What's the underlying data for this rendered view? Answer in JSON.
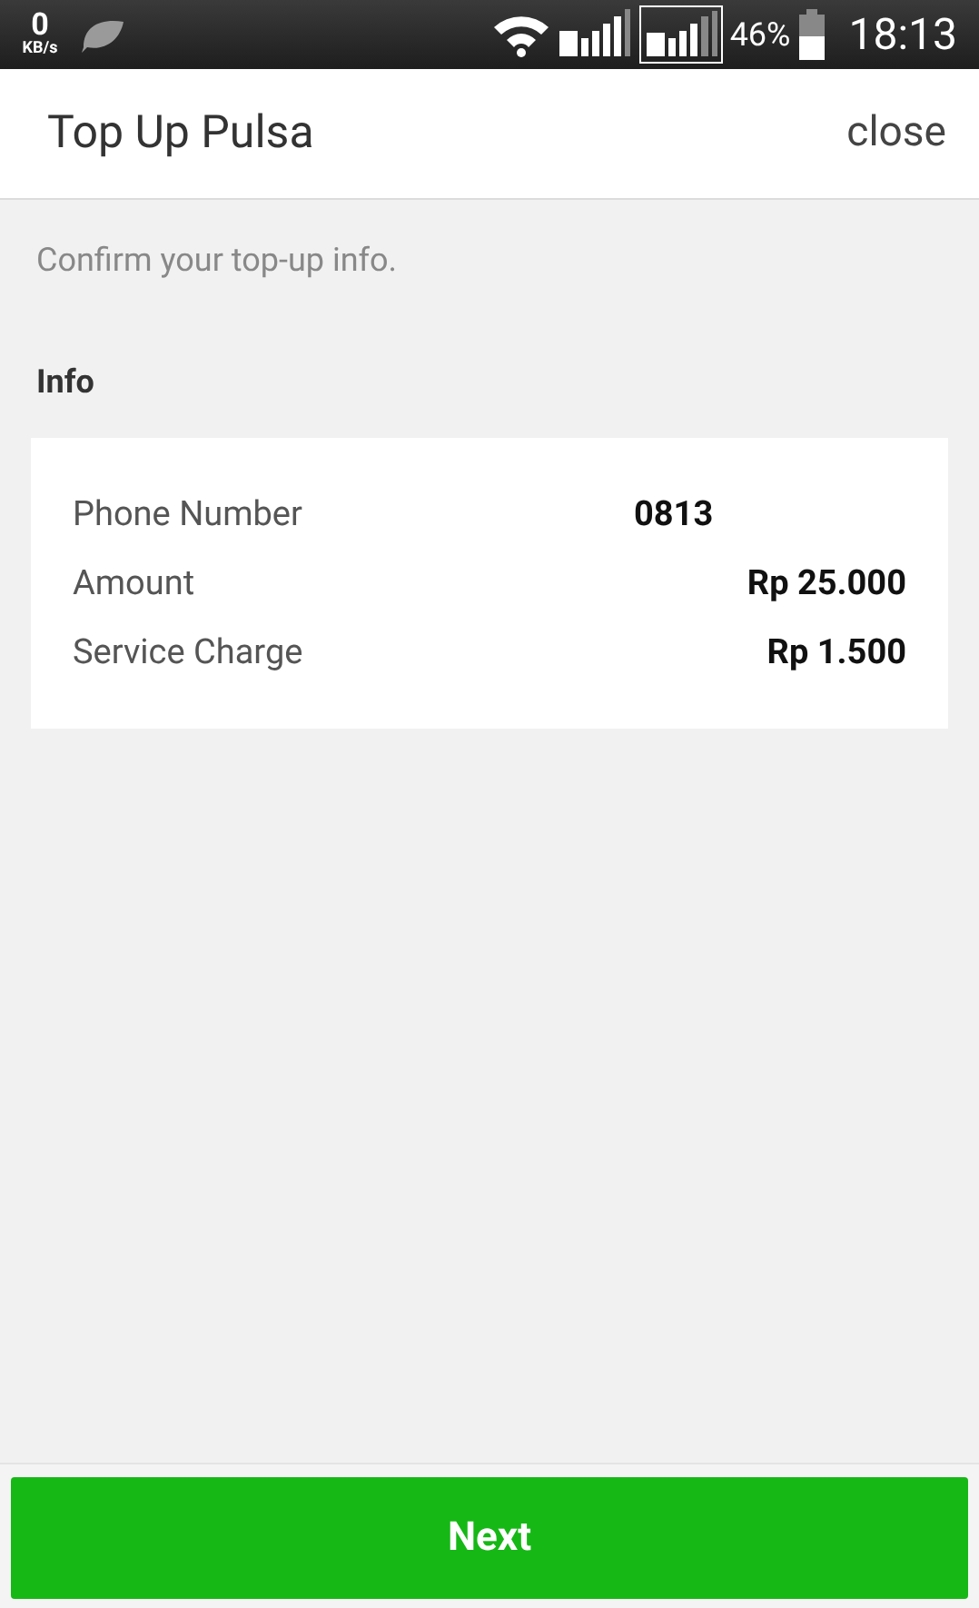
{
  "status_bar": {
    "speed": "0",
    "speed_unit": "KB/s",
    "battery": "46%",
    "time": "18:13"
  },
  "header": {
    "title": "Top Up Pulsa",
    "close": "close"
  },
  "prompt": "Confirm your top-up info.",
  "section_title": "Info",
  "info_rows": [
    {
      "label": "Phone Number",
      "value": "0813",
      "kind": "phone"
    },
    {
      "label": "Amount",
      "value": "Rp 25.000",
      "kind": "money"
    },
    {
      "label": "Service Charge",
      "value": "Rp 1.500",
      "kind": "money"
    }
  ],
  "next_button": "Next"
}
